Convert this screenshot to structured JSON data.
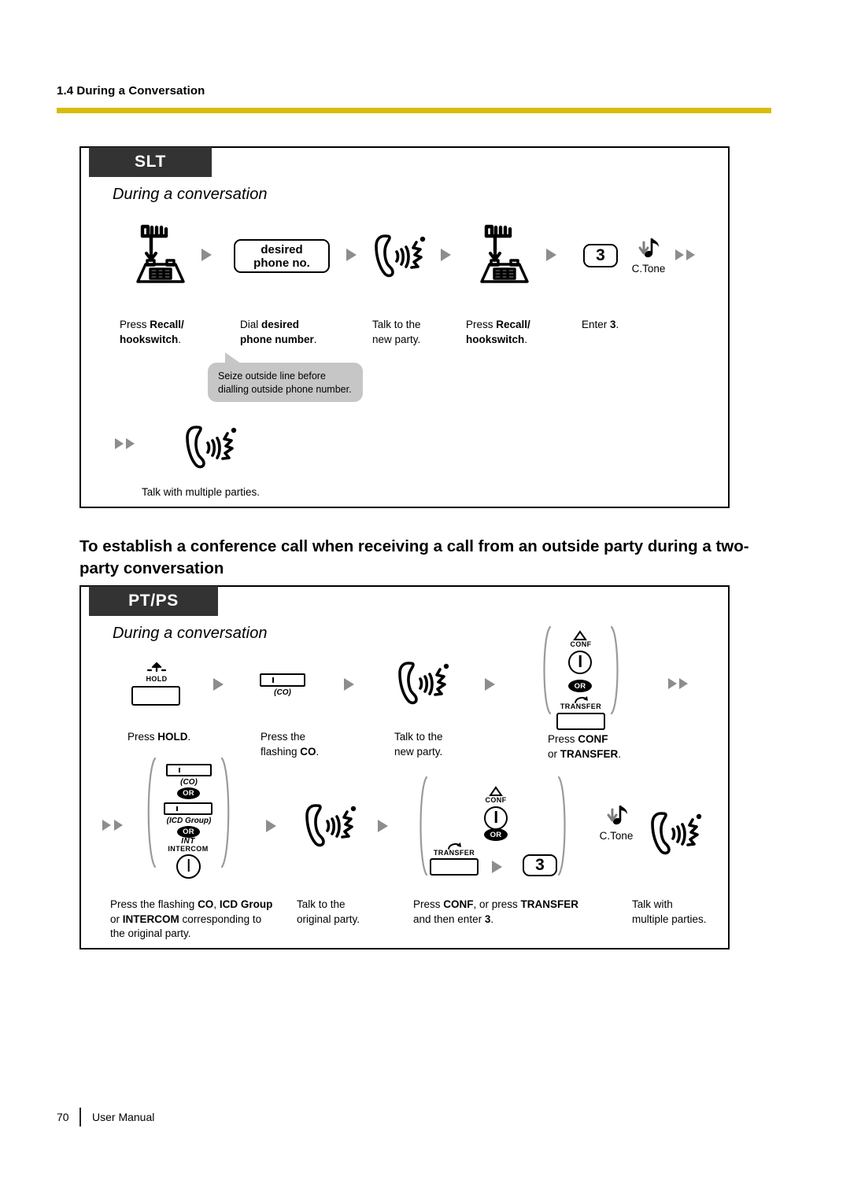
{
  "running_head": "1.4 During a Conversation",
  "accent_color": "#D9BC0A",
  "tab_color": "#333333",
  "section_heading": "To establish a conference call when receiving a call from an outside party during a two-party conversation",
  "slt_box": {
    "tab_label": "SLT",
    "subtitle": "During a conversation",
    "steps": [
      {
        "icon": "hookswitch-icon",
        "caption_lines": [
          "Press <b>Recall/</b>",
          "<b>hookswitch</b>."
        ]
      },
      {
        "icon": "phone-number-key",
        "key_line1": "desired",
        "key_line2": "phone no.",
        "caption_lines": [
          "Dial <b>desired</b>",
          "<b>phone number</b>."
        ]
      },
      {
        "icon": "talk-icon",
        "caption_lines": [
          "Talk to the",
          "new party."
        ]
      },
      {
        "icon": "hookswitch-icon",
        "caption_lines": [
          "Press <b>Recall/</b>",
          "<b>hookswitch</b>."
        ]
      },
      {
        "icon": "digit-key",
        "key_digit": "3",
        "tone_label": "C.Tone",
        "caption_lines": [
          "Enter <b>3</b>."
        ]
      }
    ],
    "callout": {
      "line1": "Seize outside line before",
      "line2": "dialling outside phone number."
    },
    "final_step": {
      "icon": "talk-icon",
      "caption": "Talk with multiple parties."
    }
  },
  "ptps_box": {
    "tab_label": "PT/PS",
    "subtitle": "During a conversation",
    "row1": [
      {
        "icon": "hold-button",
        "key_label": "HOLD",
        "caption_lines": [
          "Press <b>HOLD</b>."
        ]
      },
      {
        "icon": "co-button",
        "key_label": "(CO)",
        "caption_lines": [
          "Press the",
          "flashing <b>CO</b>."
        ]
      },
      {
        "icon": "talk-icon",
        "caption_lines": [
          "Talk to the",
          "new party."
        ]
      },
      {
        "icon": "conf-transfer-group",
        "conf_label": "CONF",
        "or_label": "OR",
        "transfer_label": "TRANSFER",
        "caption_lines": [
          "Press <b>CONF</b>",
          "or <b>TRANSFER</b>."
        ]
      }
    ],
    "row2": [
      {
        "icon": "co-icd-intercom-group",
        "co_label": "(CO)",
        "or_label": "OR",
        "icd_label": "(ICD Group)",
        "int_label": "INT",
        "intercom_label": "INTERCOM",
        "caption_lines": [
          "Press the flashing <b>CO</b>, <b>ICD Group</b>",
          "or <b>INTERCOM</b> corresponding to",
          "the original party."
        ]
      },
      {
        "icon": "talk-icon",
        "caption_lines": [
          "Talk to the",
          "original party."
        ]
      },
      {
        "icon": "conf-transfer-digit-group",
        "conf_label": "CONF",
        "or_label": "OR",
        "transfer_label": "TRANSFER",
        "key_digit": "3",
        "caption_lines": [
          "Press <b>CONF</b>, or press <b>TRANSFER</b>",
          "and then enter <b>3</b>."
        ]
      },
      {
        "icon": "talk-icon",
        "tone_label": "C.Tone",
        "caption_lines": [
          "Talk with",
          "multiple parties."
        ]
      }
    ]
  },
  "footer": {
    "page_number": "70",
    "manual_label": "User Manual"
  }
}
